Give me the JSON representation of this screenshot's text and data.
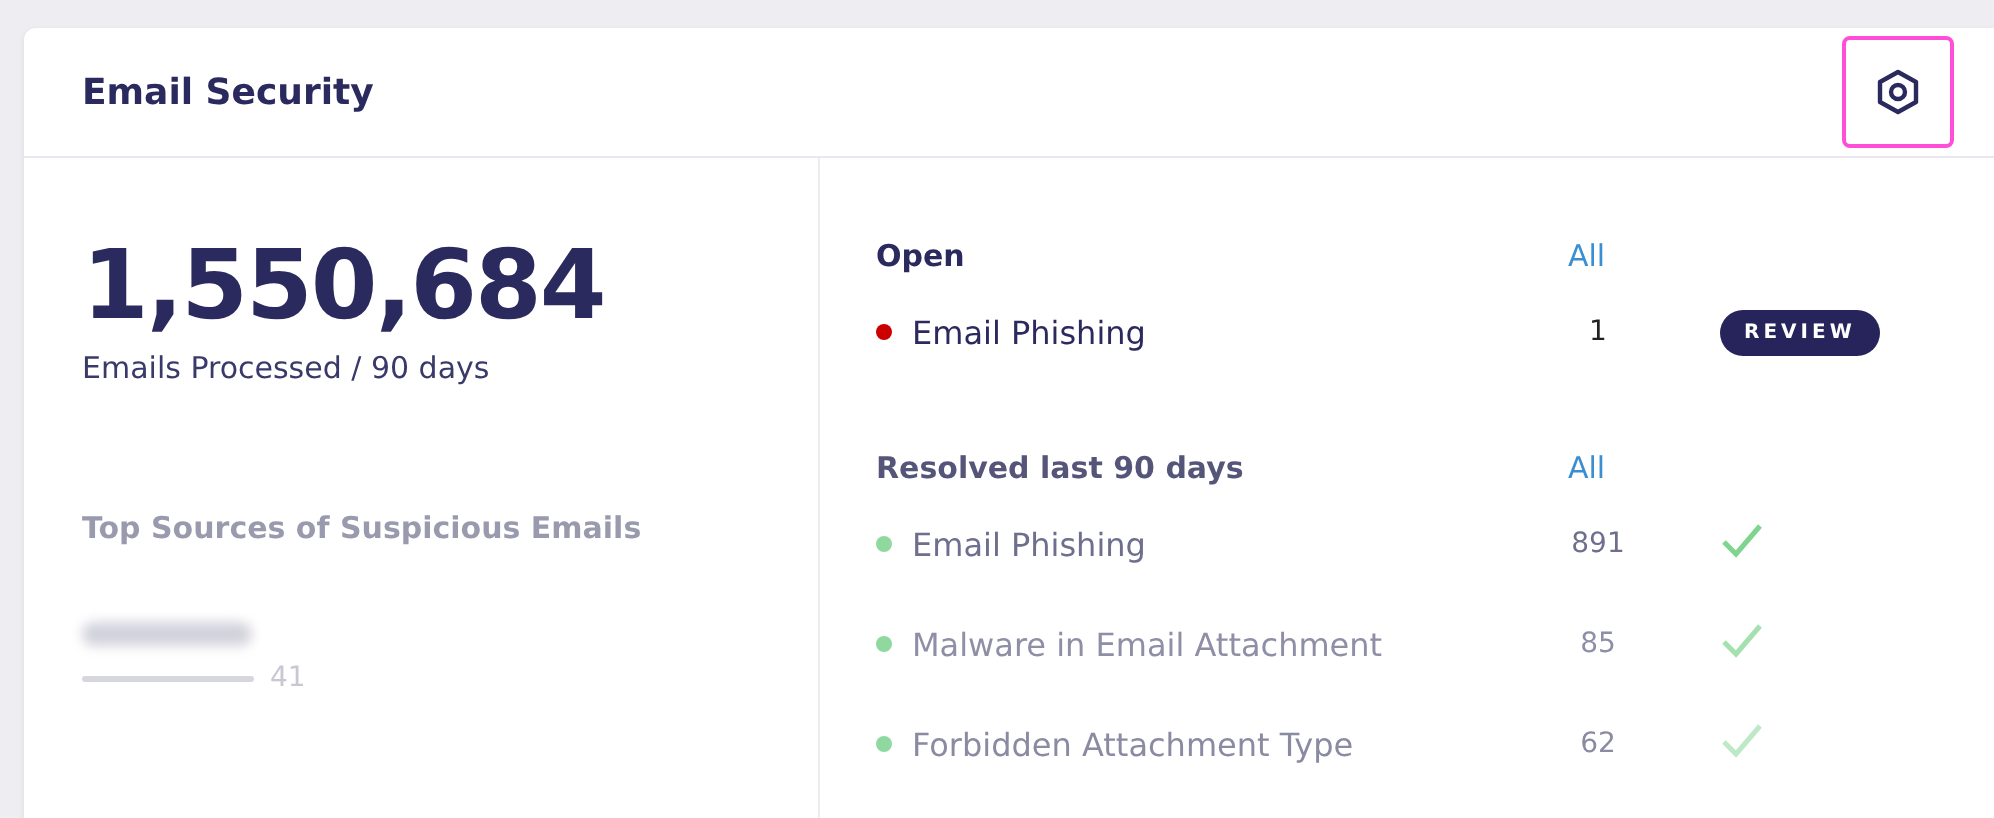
{
  "card": {
    "title": "Email Security"
  },
  "summary": {
    "value": "1,550,684",
    "caption": "Emails Processed / 90 days"
  },
  "sources": {
    "title": "Top Sources of Suspicious Emails",
    "items": [
      {
        "count": "41"
      }
    ]
  },
  "open": {
    "title": "Open",
    "link": "All",
    "rows": [
      {
        "name": "Email Phishing",
        "count": "1",
        "color": "#cc0000",
        "kind": "review",
        "action": "REVIEW"
      }
    ]
  },
  "resolved": {
    "title": "Resolved last 90 days",
    "link": "All",
    "rows": [
      {
        "name": "Email Phishing",
        "count": "891",
        "color": "#8fd9a0",
        "kind": "check"
      },
      {
        "name": "Malware in Email Attachment",
        "count": "85",
        "color": "#8fd9a0",
        "kind": "check"
      },
      {
        "name": "Forbidden Attachment Type",
        "count": "62",
        "color": "#8fd9a0",
        "kind": "check"
      }
    ]
  }
}
